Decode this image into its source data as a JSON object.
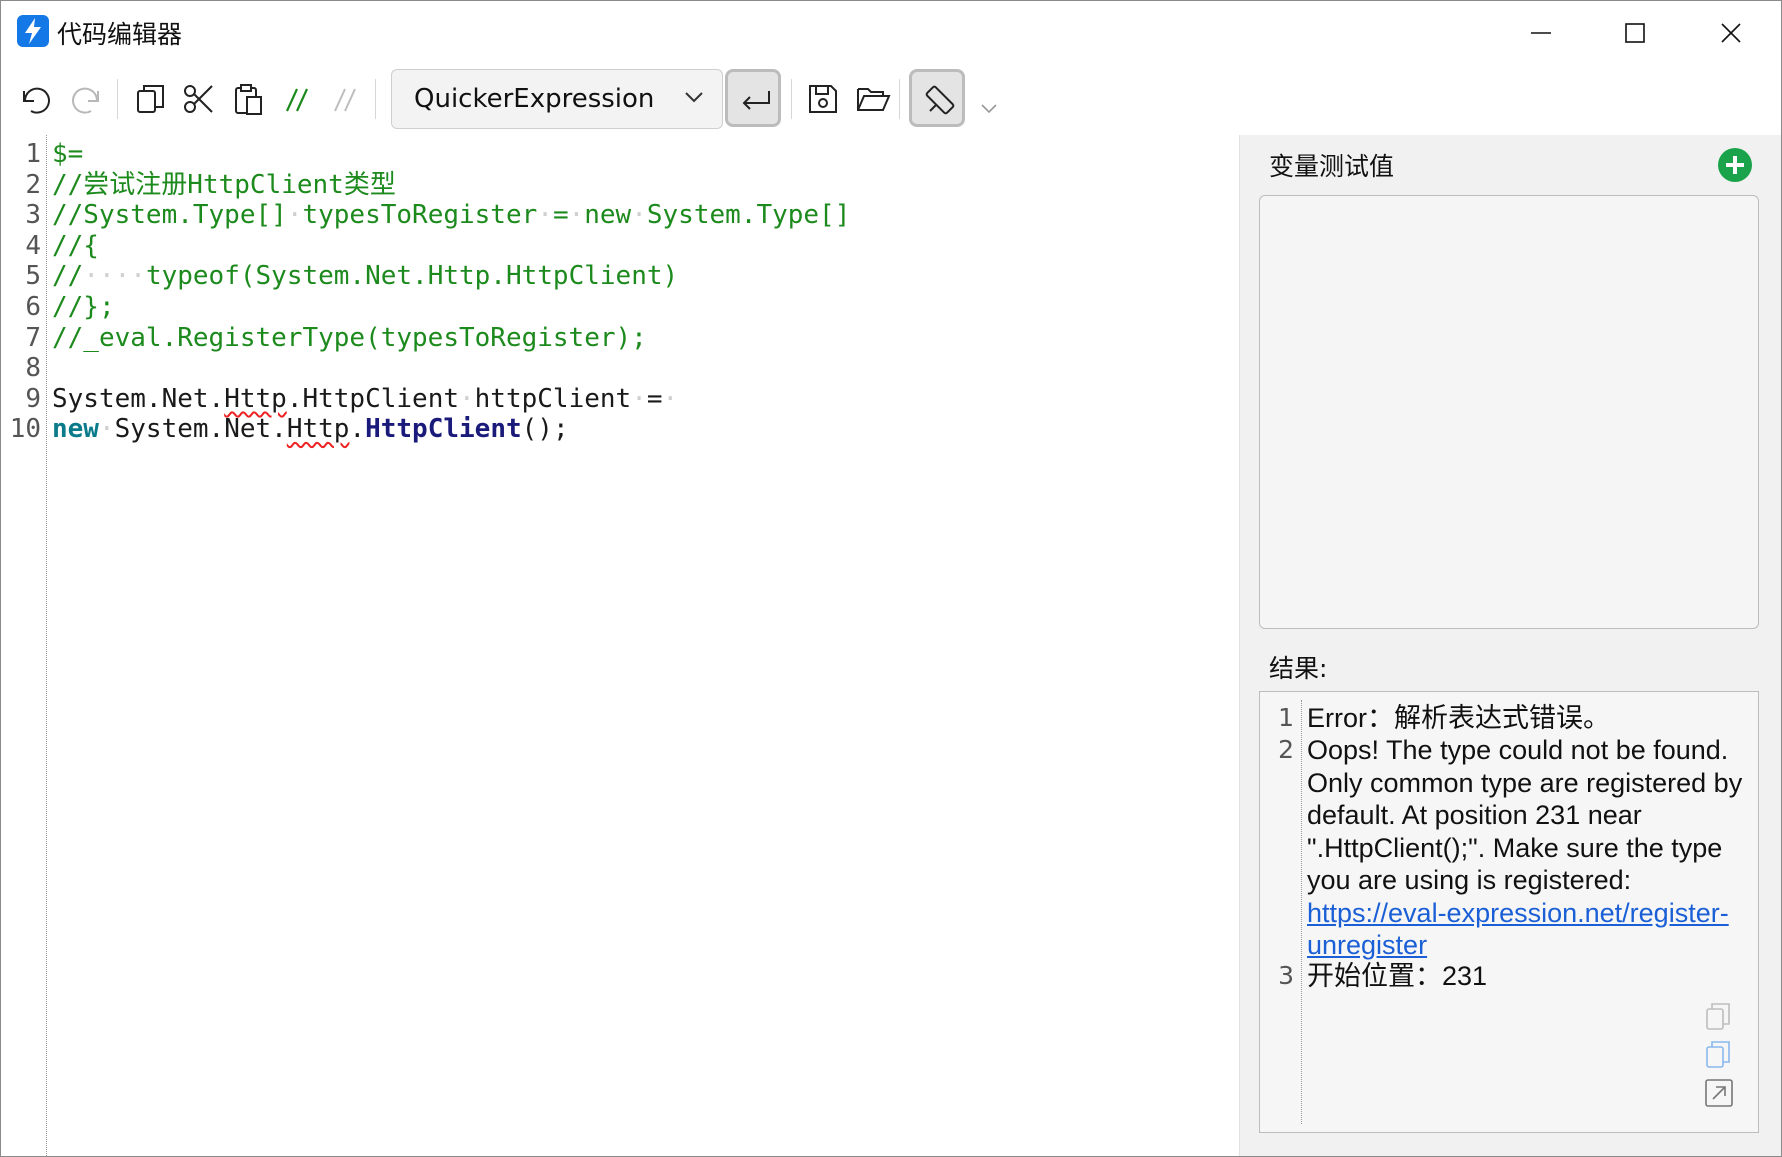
{
  "window": {
    "title": "代码编辑器",
    "controls": {
      "minimize": "minimize-icon",
      "maximize": "maximize-icon",
      "close": "close-icon"
    }
  },
  "toolbar": {
    "items": [
      "undo-icon",
      "redo-icon",
      "copy-icon",
      "cut-icon",
      "paste-icon",
      "comment-icon",
      "uncomment-icon"
    ],
    "language_select": {
      "value": "QuickerExpression"
    },
    "toggles": [
      "word-wrap-icon",
      "format-brush-icon"
    ],
    "file_actions": [
      "save-icon",
      "open-folder-icon"
    ],
    "overflow": "chevron-down-icon"
  },
  "editor": {
    "lines": [
      {
        "n": "1",
        "tokens": [
          {
            "t": "$=",
            "cls": "c-green"
          }
        ]
      },
      {
        "n": "2",
        "tokens": [
          {
            "t": "//尝试注册HttpClient类型",
            "cls": "c-green"
          }
        ]
      },
      {
        "n": "3",
        "tokens": [
          {
            "t": "//System.Type[]",
            "cls": "c-green"
          },
          {
            "t": "·",
            "cls": "ws"
          },
          {
            "t": "typesToRegister",
            "cls": "c-green"
          },
          {
            "t": "·",
            "cls": "ws"
          },
          {
            "t": "=",
            "cls": "c-green"
          },
          {
            "t": "·",
            "cls": "ws"
          },
          {
            "t": "new",
            "cls": "c-green"
          },
          {
            "t": "·",
            "cls": "ws"
          },
          {
            "t": "System.Type[]",
            "cls": "c-green"
          }
        ]
      },
      {
        "n": "4",
        "tokens": [
          {
            "t": "//{",
            "cls": "c-green"
          }
        ]
      },
      {
        "n": "5",
        "tokens": [
          {
            "t": "//",
            "cls": "c-green"
          },
          {
            "t": "····",
            "cls": "ws"
          },
          {
            "t": "typeof(System.Net.Http.HttpClient)",
            "cls": "c-green"
          }
        ]
      },
      {
        "n": "6",
        "tokens": [
          {
            "t": "//};",
            "cls": "c-green"
          }
        ]
      },
      {
        "n": "7",
        "tokens": [
          {
            "t": "//_eval.RegisterType(typesToRegister);",
            "cls": "c-green"
          }
        ]
      },
      {
        "n": "8",
        "tokens": []
      },
      {
        "n": "9",
        "tokens": [
          {
            "t": "System.Net.",
            "cls": "c-black"
          },
          {
            "t": "Http",
            "cls": "c-black squiggle"
          },
          {
            "t": ".HttpClient",
            "cls": "c-black"
          },
          {
            "t": "·",
            "cls": "ws"
          },
          {
            "t": "httpClient",
            "cls": "c-black"
          },
          {
            "t": "·",
            "cls": "ws"
          },
          {
            "t": "=",
            "cls": "c-black"
          },
          {
            "t": "·",
            "cls": "ws"
          }
        ]
      },
      {
        "n": "10",
        "tokens": [
          {
            "t": "new",
            "cls": "c-teal"
          },
          {
            "t": "·",
            "cls": "ws"
          },
          {
            "t": "System.Net.",
            "cls": "c-black"
          },
          {
            "t": "Http",
            "cls": "c-black squiggle"
          },
          {
            "t": ".",
            "cls": "c-black"
          },
          {
            "t": "HttpClient",
            "cls": "c-navy"
          },
          {
            "t": "();",
            "cls": "c-black"
          }
        ]
      }
    ]
  },
  "panel": {
    "var_label": "变量测试值",
    "add_icon": "plus-circle-icon",
    "result_label": "结果:",
    "results": [
      {
        "n": "1",
        "text": "Error：解析表达式错误。"
      },
      {
        "n": "2",
        "text": "Oops! The type could not be found. Only common type are registered by default. At position 231 near \".HttpClient();\". Make sure the type you are using is registered: ",
        "link": "https://eval-expression.net/register-unregister"
      },
      {
        "n": "3",
        "text": "开始位置：231"
      }
    ],
    "result_actions": [
      "copy-icon",
      "copy-blue-icon",
      "open-external-icon"
    ]
  },
  "colors": {
    "accent": "#1478e6",
    "comment": "#1d8a1d",
    "keyword": "#0a7b8a",
    "type": "#1a1a7a",
    "link": "#1a5fd6",
    "add": "#1aa34a"
  }
}
